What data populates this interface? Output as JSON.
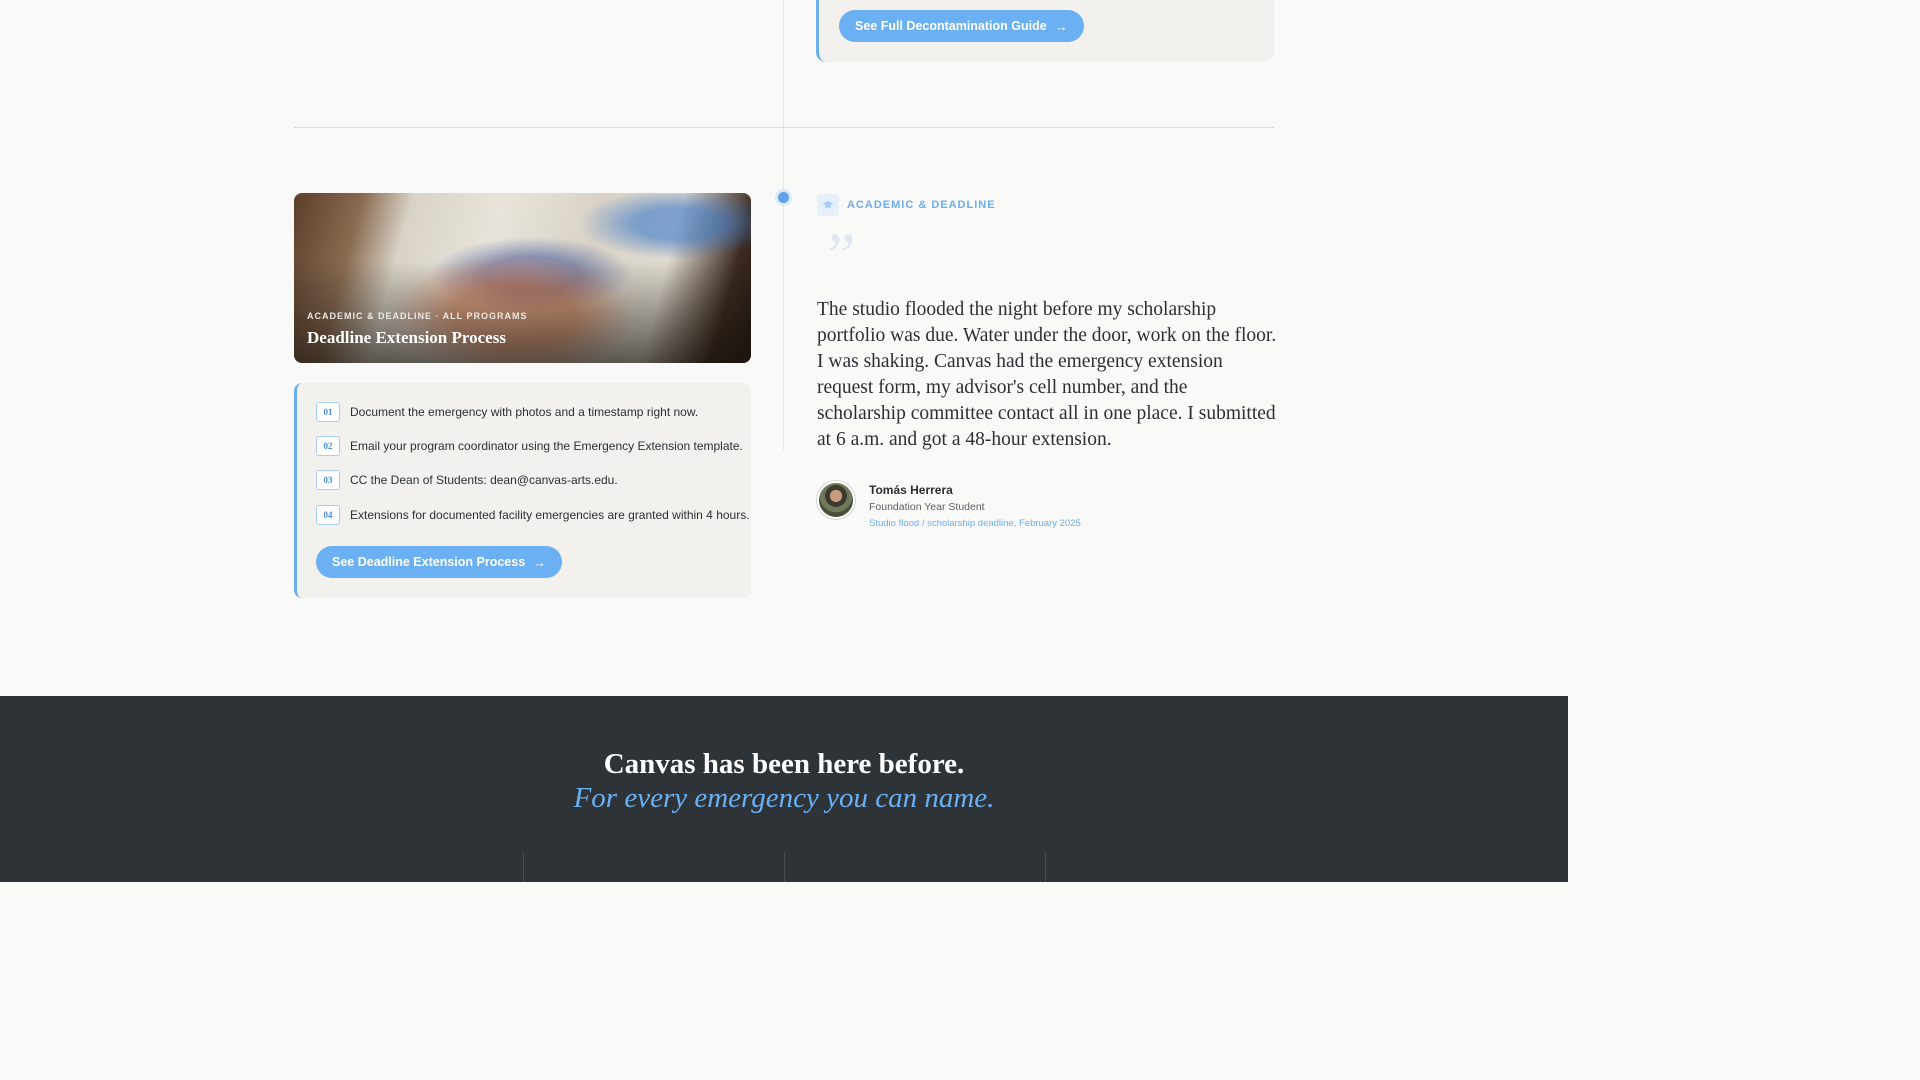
{
  "top_card": {
    "button_label": "See Full Decontamination Guide"
  },
  "hero": {
    "eyebrow": "ACADEMIC & DEADLINE · ALL PROGRAMS",
    "title": "Deadline Extension Process"
  },
  "steps": [
    {
      "num": "01",
      "text": "Document the emergency with photos and a timestamp right now."
    },
    {
      "num": "02",
      "text": "Email your program coordinator using the Emergency Extension template."
    },
    {
      "num": "03",
      "text": "CC the Dean of Students: dean@canvas-arts.edu."
    },
    {
      "num": "04",
      "text": "Extensions for documented facility emergencies are granted within 4 hours."
    }
  ],
  "steps_button_label": "See Deadline Extension Process",
  "testimonial": {
    "category": "ACADEMIC & DEADLINE",
    "quote_mark": "”",
    "quote": "The studio flooded the night before my scholarship portfolio was due. Water under the door, work on the floor. I was shaking. Canvas had the emergency extension request form, my advisor's cell number, and the scholarship committee contact all in one place. I submitted at 6 a.m. and got a 48-hour extension.",
    "author_name": "Tomás Herrera",
    "author_role": "Foundation Year Student",
    "author_context": "Studio flood / scholarship deadline, February 2025"
  },
  "footer": {
    "headline": "Canvas has been here before.",
    "subheadline": "For every emergency you can name."
  },
  "icons": {
    "arrow": "arrow-right-icon",
    "category": "graduation-cap-icon"
  },
  "colors": {
    "accent": "#6ab0f3",
    "card_bg": "#f3f1ed",
    "footer_bg": "#2e3338"
  }
}
